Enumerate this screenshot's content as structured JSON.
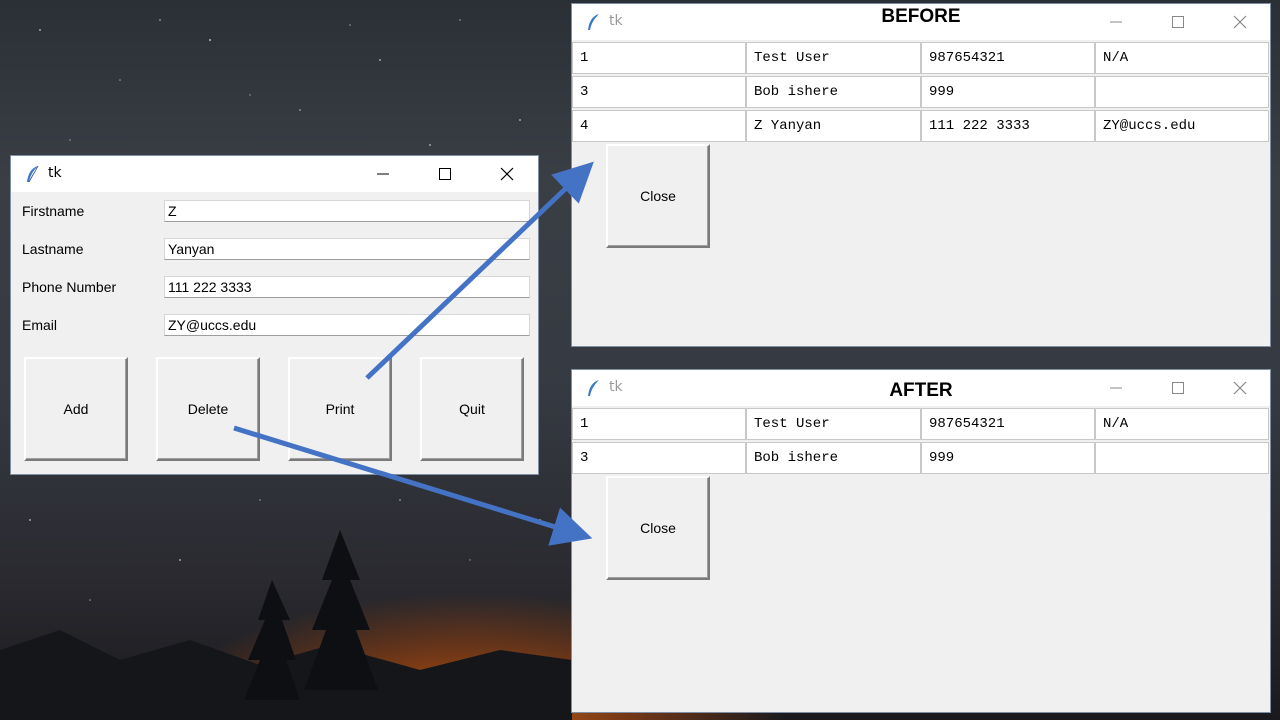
{
  "form_window": {
    "title": "tk",
    "fields": [
      {
        "label": "Firstname",
        "value": "Z"
      },
      {
        "label": "Lastname",
        "value": "Yanyan"
      },
      {
        "label": "Phone Number",
        "value": "111 222 3333"
      },
      {
        "label": "Email",
        "value": "ZY@uccs.edu"
      }
    ],
    "buttons": {
      "add": "Add",
      "delete": "Delete",
      "print": "Print",
      "quit": "Quit"
    }
  },
  "before_window": {
    "title": "tk",
    "banner": "BEFORE",
    "rows": [
      [
        "1",
        "Test User",
        "987654321",
        "N/A"
      ],
      [
        "3",
        "Bob ishere",
        "999",
        ""
      ],
      [
        "4",
        "Z Yanyan",
        "111 222 3333",
        "ZY@uccs.edu"
      ]
    ],
    "close_label": "Close"
  },
  "after_window": {
    "title": "tk",
    "banner": "AFTER",
    "rows": [
      [
        "1",
        "Test User",
        "987654321",
        "N/A"
      ],
      [
        "3",
        "Bob ishere",
        "999",
        ""
      ]
    ],
    "close_label": "Close"
  },
  "colors": {
    "arrow": "#4472c4",
    "title_icon": "#3a78c9"
  }
}
